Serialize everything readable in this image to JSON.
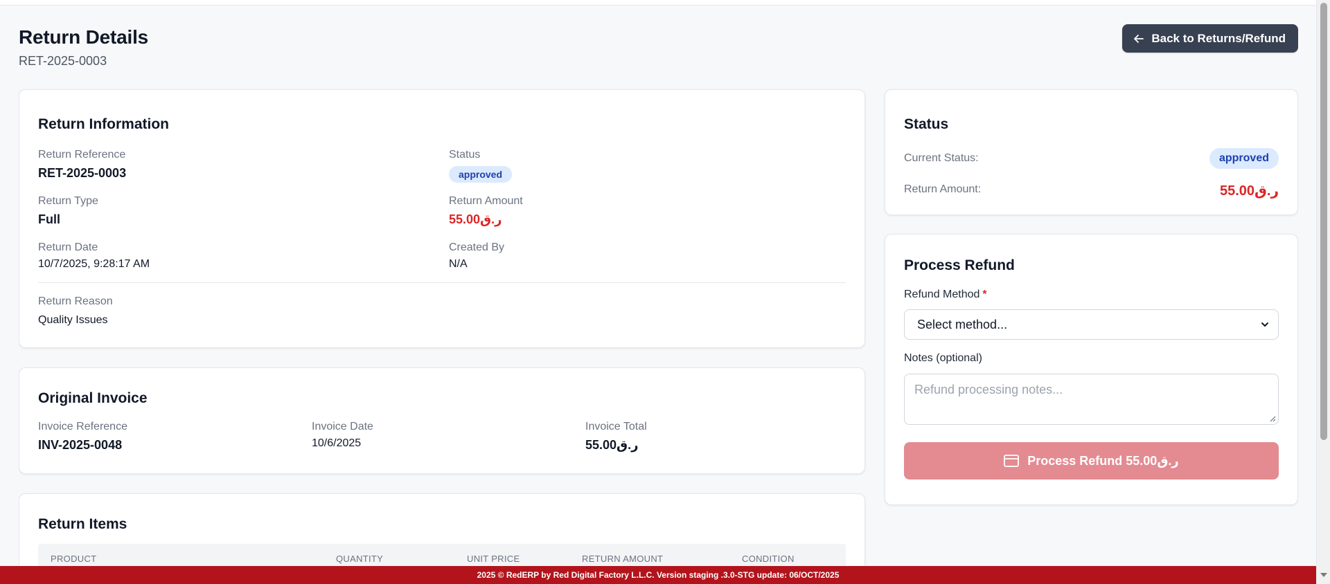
{
  "header": {
    "title": "Return Details",
    "reference": "RET-2025-0003",
    "back_label": "Back to Returns/Refund"
  },
  "return_info": {
    "title": "Return Information",
    "reference_label": "Return Reference",
    "reference_value": "RET-2025-0003",
    "status_label": "Status",
    "status_value": "approved",
    "type_label": "Return Type",
    "type_value": "Full",
    "amount_label": "Return Amount",
    "amount_value": "55.00ر.ق",
    "date_label": "Return Date",
    "date_value": "10/7/2025, 9:28:17 AM",
    "created_by_label": "Created By",
    "created_by_value": "N/A",
    "reason_label": "Return Reason",
    "reason_value": "Quality Issues"
  },
  "invoice": {
    "title": "Original Invoice",
    "reference_label": "Invoice Reference",
    "reference_value": "INV-2025-0048",
    "date_label": "Invoice Date",
    "date_value": "10/6/2025",
    "total_label": "Invoice Total",
    "total_value": "55.00ر.ق"
  },
  "return_items": {
    "title": "Return Items",
    "columns": [
      "PRODUCT",
      "QUANTITY",
      "UNIT PRICE",
      "RETURN AMOUNT",
      "CONDITION"
    ]
  },
  "status_card": {
    "title": "Status",
    "current_label": "Current Status:",
    "current_value": "approved",
    "amount_label": "Return Amount:",
    "amount_value": "55.00ر.ق"
  },
  "refund": {
    "title": "Process Refund",
    "method_label": "Refund Method",
    "method_required": "*",
    "method_value": "Select method...",
    "notes_label": "Notes (optional)",
    "notes_placeholder": "Refund processing notes...",
    "button_label": "Process Refund 55.00ر.ق"
  },
  "footer": {
    "text": "2025 © RedERP by Red Digital Factory L.L.C. Version staging .3.0-STG update: 06/OCT/2025"
  },
  "colors": {
    "accent_red": "#dc2626",
    "footer_red": "#b3141c",
    "button_dark": "#374151",
    "badge_bg": "#dbeafe",
    "badge_text": "#1e40af",
    "refund_button_disabled": "#e38b91"
  },
  "icons": {
    "back": "arrow-left-icon",
    "card": "credit-card-icon",
    "select": "chevron-down-icon"
  }
}
